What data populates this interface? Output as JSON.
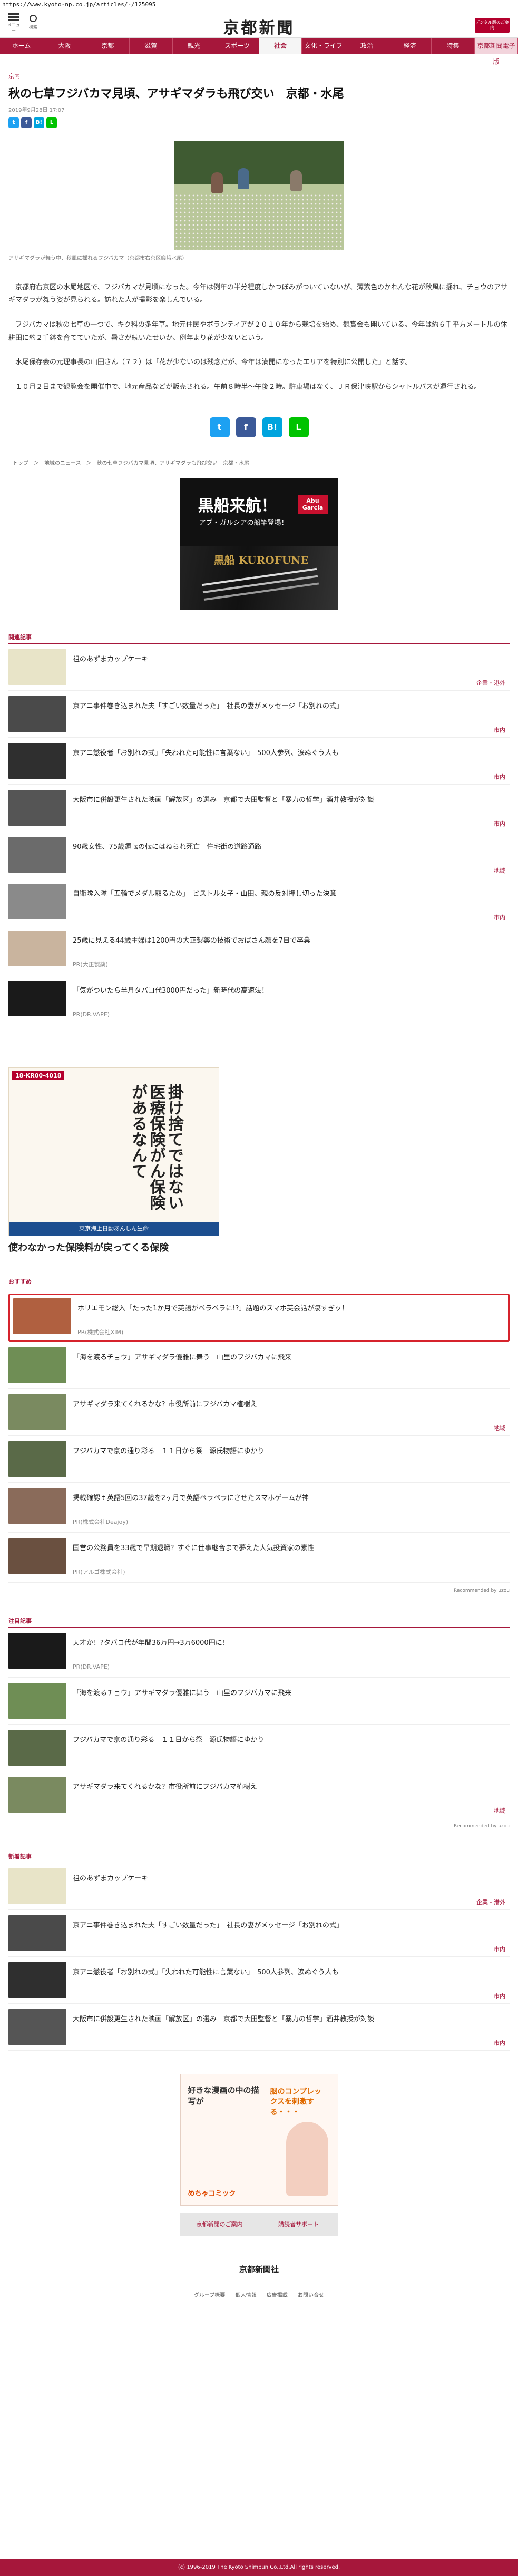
{
  "url": "https://www.kyoto-np.co.jp/articles/-/125095",
  "header": {
    "menu_label": "メニュー",
    "search_label": "検索",
    "logo": "京都新聞",
    "digital_badge": "デジタル版のご案内"
  },
  "nav": [
    "ホーム",
    "大阪",
    "京都",
    "滋賀",
    "観光",
    "スポーツ",
    "社会",
    "文化・ライフ",
    "政治",
    "経済",
    "特集",
    "京都新聞電子版"
  ],
  "article": {
    "section": "京内",
    "title": "秋の七草フジバカマ見頃、アサギマダラも飛び交い　京都・水尾",
    "date": "2019年9月28日 17:07",
    "caption": "アサギマダラが舞う中、秋風に揺れるフジバカマ（京都市右京区嵯峨水尾）",
    "paragraphs": [
      "京都府右京区の水尾地区で、フジバカマが見頃になった。今年は例年の半分程度しかつぼみがついていないが、薄紫色のかれんな花が秋風に揺れ、チョウのアサギマダラが舞う姿が見られる。訪れた人が撮影を楽しんでいる。",
      "フジバカマは秋の七草の一つで、キク科の多年草。地元住民やボランティアが２０１０年から栽培を始め、観賞会も開いている。今年は約６千平方メートルの休耕田に約２千鉢を育てていたが、暑さが続いたせいか、例年より花が少ないという。",
      "水尾保存会の元理事長の山田さん（７２）は「花が少ないのは残念だが、今年は満開になったエリアを特別に公開した」と話す。",
      "１０月２日まで観覧会を開催中で、地元産品などが販売される。午前８時半～午後２時。駐車場はなく、ＪＲ保津峡駅からシャトルバスが運行される。"
    ],
    "breadcrumb": "トップ　＞　地域のニュース　＞　秋の七草フジバカマ見頃、アサギマダラも飛び交い　京都・水尾"
  },
  "ad_fishing": {
    "line1": "黒船来航！",
    "line2": "アブ・ガルシアの船竿登場！",
    "brand": "Abu Garcia",
    "product": "黒船 KUROFUNE"
  },
  "related": {
    "title": "関連記事",
    "items": [
      {
        "text": "祖のあずまカップケーキ",
        "cat": "企業・港外",
        "color": "#e8e4c8"
      },
      {
        "text": "京アニ事件巻き込まれた夫「すごい数量だった」　社長の妻がメッセージ「お別れの式」",
        "cat": "市内",
        "color": "#4a4a4a"
      },
      {
        "text": "京アニ懲役者「お別れの式」「失われた可能性に言葉ない」　500人参列、涙ぬぐう人も",
        "cat": "市内",
        "color": "#2f2f2f"
      },
      {
        "text": "大阪市に併設更生された映画「解放区」の選み　京都で大田監督と「暴力の哲学」酒井教授が対談",
        "cat": "市内",
        "color": "#555"
      },
      {
        "text": "90歳女性、75歳運転の転にはねられ死亡　住宅街の道路通路",
        "cat": "地域",
        "color": "#6b6b6b"
      },
      {
        "text": "自衛隊入隊「五輪でメダル取るため」　ピストル女子・山田、親の反対押し切った決意",
        "cat": "市内",
        "color": "#8a8a8a"
      },
      {
        "text": "25歳に見える44歳主婦は1200円の大正製薬の技術でおばさん顔を7日で卒業",
        "cat": "PR(大正製薬)",
        "color": "#c9b49e"
      },
      {
        "text": "「気がついたら半月タバコ代3000円だった」新時代の高速法！",
        "cat": "PR(DR.VAPE)",
        "color": "#1a1a1a"
      }
    ]
  },
  "ad_insurance": {
    "code": "18-KR00-4018",
    "vertical": "掛け捨てではない医療保険がん保険があるなんて",
    "footer": "東京海上日動あんしん生命",
    "headline": "使わなかった保険料が戻ってくる保険"
  },
  "recommend": {
    "title": "おすすめ",
    "items": [
      {
        "text": "ホリエモン総入「たった1か月で英語がペラペラに!?」話題のスマホ英会話が凄すぎッ！",
        "cat": "PR(株式会社XIM)",
        "color": "#b06040",
        "highlight": true
      },
      {
        "text": "「海を渡るチョウ」アサギマダラ優雅に舞う　山里のフジバカマに飛来",
        "cat": "",
        "color": "#6f8e55",
        "highlight": false
      },
      {
        "text": "アサギマダラ来てくれるかな？市役所前にフジバカマ植樹え",
        "cat": "地域",
        "color": "#7a8a60",
        "highlight": false
      },
      {
        "text": "フジバカマで京の通り彩る　１１日から祭　源氏物語にゆかり",
        "cat": "",
        "color": "#5a6a48",
        "highlight": false
      },
      {
        "text": "掲載確認ｔ英語5回の37歳を2ヶ月で英語ペラペラにさせたスマホゲームが神",
        "cat": "PR(株式会社Deajoy)",
        "color": "#8a6b5a",
        "highlight": false
      },
      {
        "text": "国営の公務員を33歳で早期退職？すぐに仕事継合まで夢えた人気投資家の素性",
        "cat": "PR(アルゴ株式会社)",
        "color": "#6a5040",
        "highlight": false
      }
    ],
    "powered": "Recommended by uzou"
  },
  "attention": {
    "title": "注目記事",
    "items": [
      {
        "text": "天才か！?タバコ代が年間36万円→3万6000円に！",
        "cat": "PR(DR.VAPE)",
        "color": "#1a1a1a"
      },
      {
        "text": "「海を渡るチョウ」アサギマダラ優雅に舞う　山里のフジバカマに飛来",
        "cat": "",
        "color": "#6f8e55"
      },
      {
        "text": "フジバカマで京の通り彩る　１１日から祭　源氏物語にゆかり",
        "cat": "",
        "color": "#5a6a48"
      },
      {
        "text": "アサギマダラ来てくれるかな？市役所前にフジバカマ植樹え",
        "cat": "地域",
        "color": "#7a8a60"
      }
    ],
    "powered": "Recommended by uzou"
  },
  "newest": {
    "title": "新着記事",
    "items": [
      {
        "text": "祖のあずまカップケーキ",
        "cat": "企業・港外",
        "color": "#e8e4c8"
      },
      {
        "text": "京アニ事件巻き込まれた夫「すごい数量だった」　社長の妻がメッセージ「お別れの式」",
        "cat": "市内",
        "color": "#4a4a4a"
      },
      {
        "text": "京アニ懲役者「お別れの式」「失われた可能性に言葉ない」　500人参列、涙ぬぐう人も",
        "cat": "市内",
        "color": "#2f2f2f"
      },
      {
        "text": "大阪市に併設更生された映画「解放区」の選み　京都で大田監督と「暴力の哲学」酒井教授が対談",
        "cat": "市内",
        "color": "#555"
      }
    ]
  },
  "ad_manga": {
    "text": "脳のコンプレックスを刺激する・・・",
    "label": "好きな漫画の中の描写が",
    "brand": "めちゃコミック"
  },
  "bottom_buttons": [
    "京都新聞のご案内",
    "購読者サポート"
  ],
  "footer": {
    "logo": "京都新聞社",
    "links": [
      "グループ概要",
      "個人情報",
      "広告掲載",
      "お問い合せ"
    ],
    "copyright": "(c) 1996-2019 The Kyoto Shimbun Co.,Ltd.All rights reserved."
  },
  "colors": {
    "accent": "#a6173b",
    "highlight": "#d6232c"
  }
}
